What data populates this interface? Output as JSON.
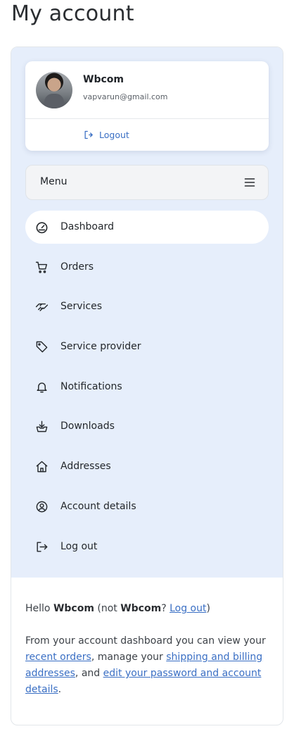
{
  "page": {
    "title": "My account"
  },
  "user": {
    "name": "Wbcom",
    "email": "vapvarun@gmail.com",
    "logout_label": "Logout"
  },
  "menu": {
    "label": "Menu"
  },
  "nav": {
    "items": [
      {
        "label": "Dashboard",
        "icon": "dashboard-icon",
        "active": true
      },
      {
        "label": "Orders",
        "icon": "cart-icon"
      },
      {
        "label": "Services",
        "icon": "handshake-icon"
      },
      {
        "label": "Service provider",
        "icon": "tag-icon"
      },
      {
        "label": "Notifications",
        "icon": "bell-icon"
      },
      {
        "label": "Downloads",
        "icon": "download-icon"
      },
      {
        "label": "Addresses",
        "icon": "home-icon"
      },
      {
        "label": "Account details",
        "icon": "user-circle-icon"
      },
      {
        "label": "Log out",
        "icon": "logout-icon"
      }
    ]
  },
  "content": {
    "hello": "Hello",
    "name_1": "Wbcom",
    "not_open": "(not",
    "name_2": "Wbcom",
    "question": "?",
    "logout_link": "Log out",
    "close_paren": ")",
    "intro": "From your account dashboard you can view your",
    "recent_orders_link": "recent orders",
    "manage": ", manage your",
    "shipping_link": "shipping and billing addresses",
    "and": ", and",
    "edit_link": "edit your password and account details",
    "period": "."
  },
  "colors": {
    "panel_bg": "#e6eefb",
    "link": "#3a6fc4",
    "text": "#1f2328"
  }
}
